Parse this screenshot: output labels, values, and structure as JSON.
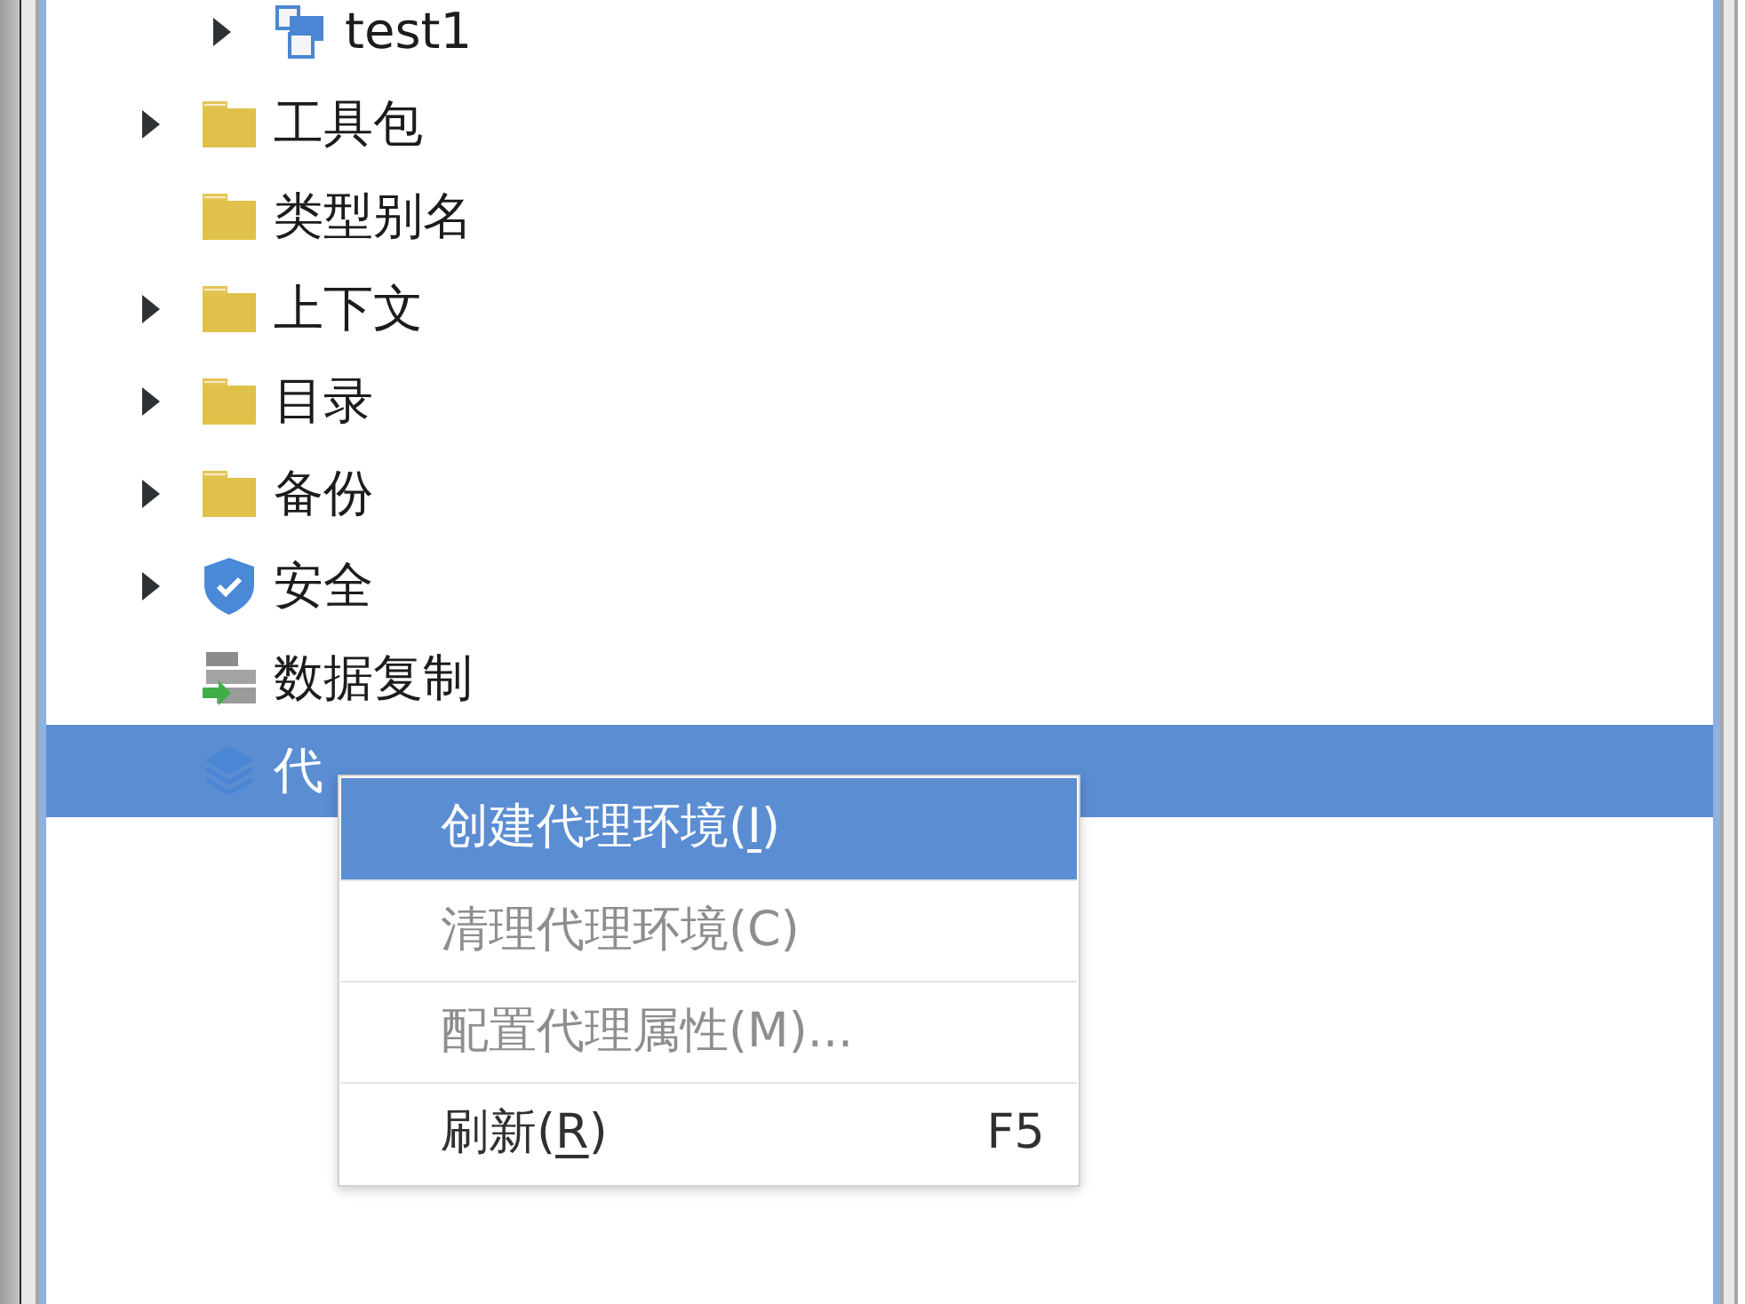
{
  "tree": {
    "partial_parent_children": [
      {
        "label": "test1",
        "expandable": true,
        "kind": "module",
        "selected": false
      }
    ],
    "items": [
      {
        "label": "工具包",
        "expandable": true,
        "kind": "folder",
        "selected": false
      },
      {
        "label": "类型别名",
        "expandable": false,
        "kind": "folder",
        "selected": false
      },
      {
        "label": "上下文",
        "expandable": true,
        "kind": "folder",
        "selected": false
      },
      {
        "label": "目录",
        "expandable": true,
        "kind": "folder",
        "selected": false
      },
      {
        "label": "备份",
        "expandable": true,
        "kind": "folder",
        "selected": false
      },
      {
        "label": "安全",
        "expandable": true,
        "kind": "shield",
        "selected": false
      },
      {
        "label": "数据复制",
        "expandable": false,
        "kind": "replication",
        "selected": false
      },
      {
        "label": "代",
        "expandable": false,
        "kind": "layers",
        "selected": true
      }
    ]
  },
  "context_menu": {
    "items": [
      {
        "text": "创建代理环境(",
        "mnemonic": "I",
        "text_after": ")",
        "disabled": false,
        "selected": true
      },
      {
        "text": "清理代理环境(C)",
        "disabled": true,
        "selected": false
      },
      {
        "text": "配置代理属性(M)...",
        "disabled": true,
        "selected": false
      },
      {
        "text": "刷新(",
        "mnemonic": "R",
        "text_after": ")",
        "shortcut": "F5",
        "disabled": false,
        "selected": false
      }
    ]
  }
}
